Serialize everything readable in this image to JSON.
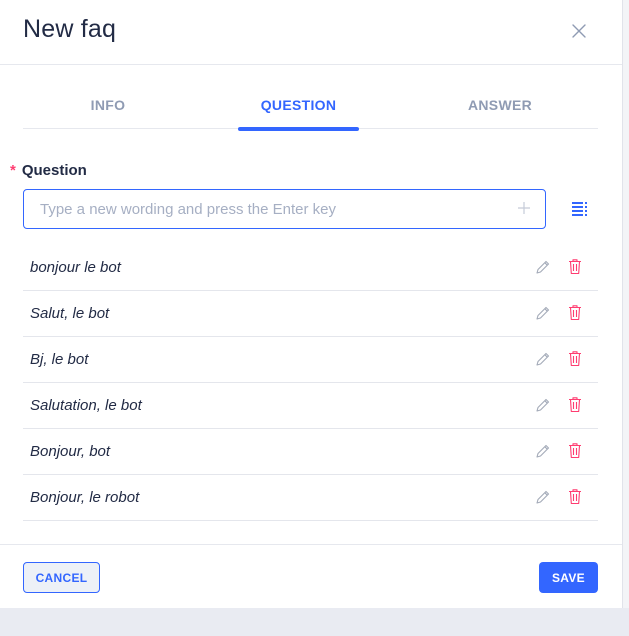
{
  "dialog": {
    "title": "New faq",
    "close_icon": "close-icon"
  },
  "tabs": [
    {
      "label": "INFO",
      "active": false
    },
    {
      "label": "QUESTION",
      "active": true
    },
    {
      "label": "ANSWER",
      "active": false
    }
  ],
  "question_field": {
    "required_mark": "*",
    "label": "Question",
    "value": "",
    "placeholder": "Type a new wording and press the Enter key",
    "add_icon": "plus-icon",
    "bulk_icon": "list-icon"
  },
  "questions": [
    {
      "text": "bonjour le bot"
    },
    {
      "text": "Salut, le bot"
    },
    {
      "text": "Bj, le bot"
    },
    {
      "text": "Salutation, le bot"
    },
    {
      "text": "Bonjour, bot"
    },
    {
      "text": "Bonjour, le robot"
    }
  ],
  "row_icons": {
    "edit": "pencil-icon",
    "delete": "trash-icon"
  },
  "footer": {
    "cancel_label": "CANCEL",
    "save_label": "SAVE"
  },
  "colors": {
    "accent": "#3366ff",
    "danger": "#ff3d71",
    "muted": "#8f9bb3"
  }
}
